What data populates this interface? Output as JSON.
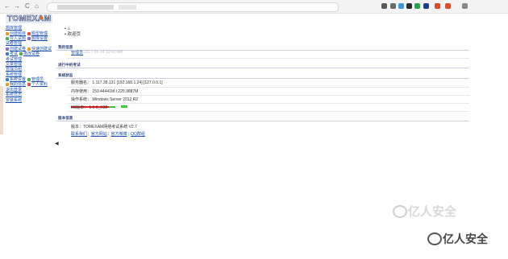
{
  "browser": {
    "nav": {
      "back": "←",
      "forward": "→",
      "reload": "C",
      "home": "⌂"
    },
    "ext_colors": [
      "#5a5a5a",
      "#6a6a6a",
      "#3b9bd8",
      "#2b2b2b",
      "#2fa04f",
      "#1d3f8f",
      "#e34a24",
      "#d84f32",
      "#888888"
    ]
  },
  "sidebar": {
    "logo": "TOMEXAM",
    "items": [
      {
        "label": "题库管理",
        "color": "#1a4fb0"
      },
      {
        "label": "创建题目",
        "label2": "题型管理",
        "color": "#1a4fb0"
      },
      {
        "label": "导入试题",
        "label2": "题库设置",
        "color": "#1a4fb0"
      },
      {
        "label": "试卷管理",
        "color": "#1a4fb0"
      },
      {
        "label": "创建试卷",
        "label2": "快速创建试",
        "color": "#1a4fb0"
      },
      {
        "label": "考试",
        "label2": "批改试卷",
        "color": "#1a4fb0"
      },
      {
        "label": "考试管理",
        "color": "#1a4fb0"
      },
      {
        "label": "文章管理",
        "color": "#1a4fb0"
      },
      {
        "label": "管理员组",
        "color": "#1a4fb0"
      },
      {
        "label": "系统管理",
        "color": "#1a4fb0"
      },
      {
        "label": "系统设置",
        "label2": "管理员",
        "color": "#1a4fb0"
      },
      {
        "label": "我的信息",
        "label2": "个人资料",
        "color": "#1a4fb0"
      },
      {
        "label": "退出登录",
        "color": "#1a4fb0"
      },
      {
        "label": "系统日志",
        "color": "#1a4fb0"
      },
      {
        "label": "安装系统",
        "color": "#1a4fb0"
      }
    ]
  },
  "main": {
    "breadcrumb": [
      "首页",
      "欢迎页"
    ],
    "sections": {
      "welcome": "我的信息",
      "running": "进行中的考试",
      "sysinfo": "系统状态",
      "version": "版本信息"
    },
    "greeting": {
      "user": "管理员",
      "time": "2017-06-14 10:43 AM"
    },
    "info": {
      "server_label": "服务器名：",
      "server_value": "1.117.38.131 [192.168.1.24] [127.0.0.1]",
      "memory_label": "内存使用：",
      "memory_value": "150.44441M / 225.9887M",
      "memory_usage": 0.67,
      "os_label": "操作系统：",
      "os_value": "Windows Server 2012 R2",
      "iis_label": "IIS版本：",
      "iis_value": "1.0.0_X32"
    },
    "version_text": "版本：TOMEXAM网络考试系统 V2.7",
    "links": [
      "联系我们",
      "官方网站",
      "官方微博",
      "QQ群组"
    ]
  },
  "watermark": "亿人安全"
}
